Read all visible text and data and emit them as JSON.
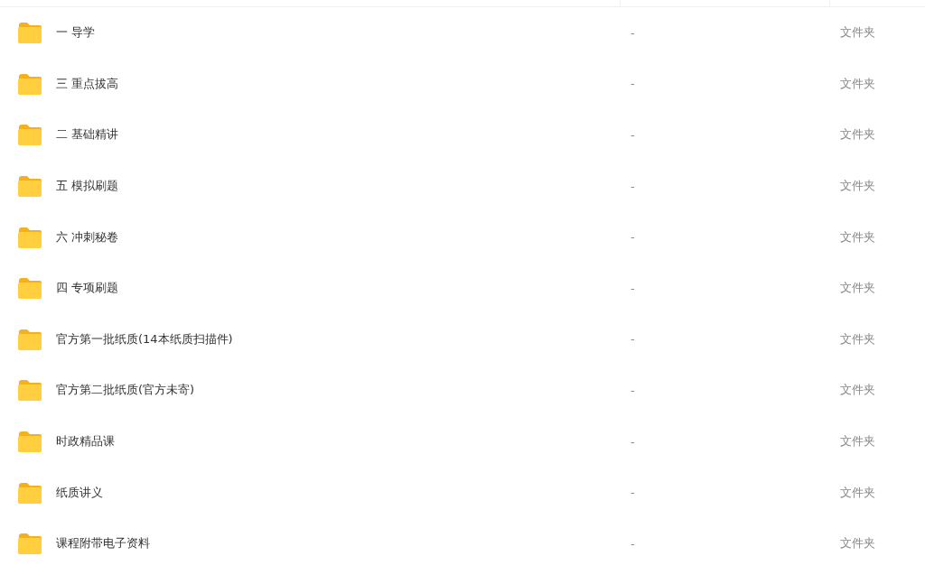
{
  "file_list": {
    "rows": [
      {
        "kind": "folder",
        "name": "一 导学",
        "size": "-",
        "type": "文件夹"
      },
      {
        "kind": "folder",
        "name": "三 重点拔高",
        "size": "-",
        "type": "文件夹"
      },
      {
        "kind": "folder",
        "name": "二 基础精讲",
        "size": "-",
        "type": "文件夹"
      },
      {
        "kind": "folder",
        "name": "五 模拟刷题",
        "size": "-",
        "type": "文件夹"
      },
      {
        "kind": "folder",
        "name": "六 冲刺秘卷",
        "size": "-",
        "type": "文件夹"
      },
      {
        "kind": "folder",
        "name": "四 专项刷题",
        "size": "-",
        "type": "文件夹"
      },
      {
        "kind": "folder",
        "name": "官方第一批纸质(14本纸质扫描件)",
        "size": "-",
        "type": "文件夹"
      },
      {
        "kind": "folder",
        "name": "官方第二批纸质(官方未寄)",
        "size": "-",
        "type": "文件夹"
      },
      {
        "kind": "folder",
        "name": "时政精品课",
        "size": "-",
        "type": "文件夹"
      },
      {
        "kind": "folder",
        "name": "纸质讲义",
        "size": "-",
        "type": "文件夹"
      },
      {
        "kind": "folder",
        "name": "课程附带电子资料",
        "size": "-",
        "type": "文件夹"
      }
    ]
  }
}
